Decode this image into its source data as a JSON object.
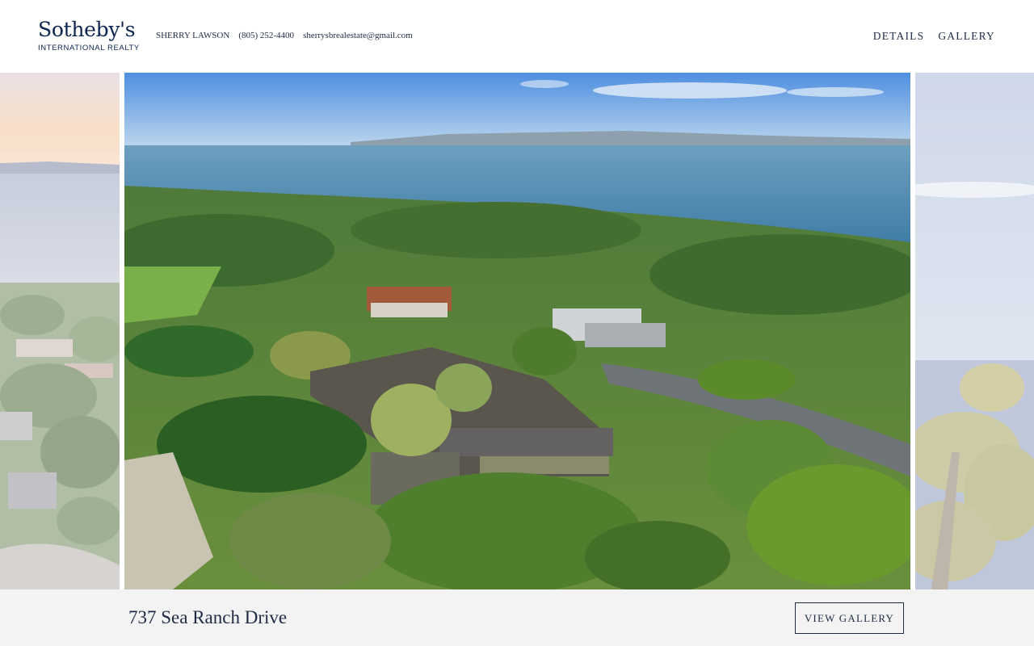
{
  "brand": {
    "name": "Sotheby's",
    "tagline": "INTERNATIONAL REALTY"
  },
  "agent": {
    "name": "SHERRY LAWSON",
    "phone": "(805) 252-4400",
    "email": "sherrysbrealestate@gmail.com"
  },
  "nav": {
    "details": "DETAILS",
    "gallery": "GALLERY"
  },
  "listing": {
    "address": "737 Sea Ranch Drive"
  },
  "footer": {
    "view_gallery_label": "VIEW GALLERY"
  },
  "colors": {
    "navy": "#0d2450",
    "text": "#1f2a44",
    "footer_bg": "#f3f3f3"
  },
  "images": {
    "left": "sunset-coastal-neighborhood-photo",
    "main": "aerial-ocean-view-estate-photo",
    "right": "ocean-view-eucalyptus-photo"
  }
}
